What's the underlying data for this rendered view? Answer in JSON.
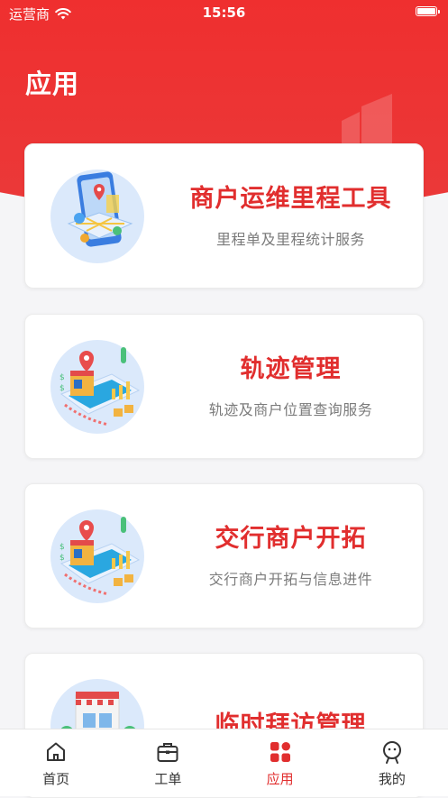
{
  "status_bar": {
    "carrier": "运营商",
    "time": "15:56",
    "wifi_icon": "wifi-icon",
    "battery_icon": "battery-icon"
  },
  "header": {
    "title": "应用"
  },
  "cards": [
    {
      "title": "商户运维里程工具",
      "subtitle": "里程单及里程统计服务",
      "icon": "map-phone-illustration"
    },
    {
      "title": "轨迹管理",
      "subtitle": "轨迹及商户位置查询服务",
      "icon": "store-location-illustration"
    },
    {
      "title": "交行商户开拓",
      "subtitle": "交行商户开拓与信息进件",
      "icon": "store-location-illustration"
    },
    {
      "title": "临时拜访管理",
      "subtitle": "",
      "icon": "storefront-illustration"
    }
  ],
  "tab_bar": {
    "tabs": [
      {
        "label": "首页",
        "icon": "home-icon",
        "active": false
      },
      {
        "label": "工单",
        "icon": "briefcase-icon",
        "active": false
      },
      {
        "label": "应用",
        "icon": "apps-grid-icon",
        "active": true
      },
      {
        "label": "我的",
        "icon": "user-icon",
        "active": false
      }
    ]
  },
  "colors": {
    "brand_red": "#e12e2e",
    "header_red": "#ef2f2f",
    "background": "#f5f5f7",
    "subtitle_gray": "#7b7b7b"
  }
}
